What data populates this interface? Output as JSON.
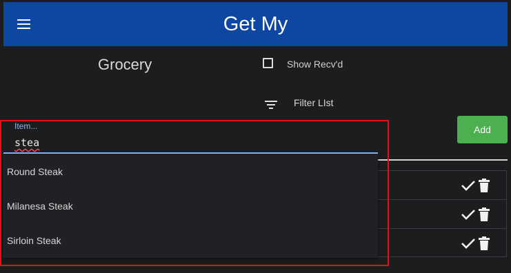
{
  "header": {
    "title": "Get My",
    "menu_icon": "menu-icon"
  },
  "list": {
    "name": "Grocery"
  },
  "controls": {
    "show_received_label": "Show Recv'd",
    "show_received_checked": false,
    "filter_label": "Filter LIst",
    "filter_icon": "filter-icon",
    "add_label": "Add"
  },
  "item_field": {
    "label": "Item...",
    "value": "stea"
  },
  "suggestions": [
    {
      "label": "Round Steak"
    },
    {
      "label": "Milanesa Steak"
    },
    {
      "label": "Sirloin Steak"
    }
  ],
  "row_actions": {
    "check_icon": "check-icon",
    "delete_icon": "trash-icon"
  },
  "colors": {
    "app_bar": "#0d47a1",
    "add_button": "#4caf50",
    "highlight": "#e01414",
    "input_underline": "#8ab4f8"
  }
}
